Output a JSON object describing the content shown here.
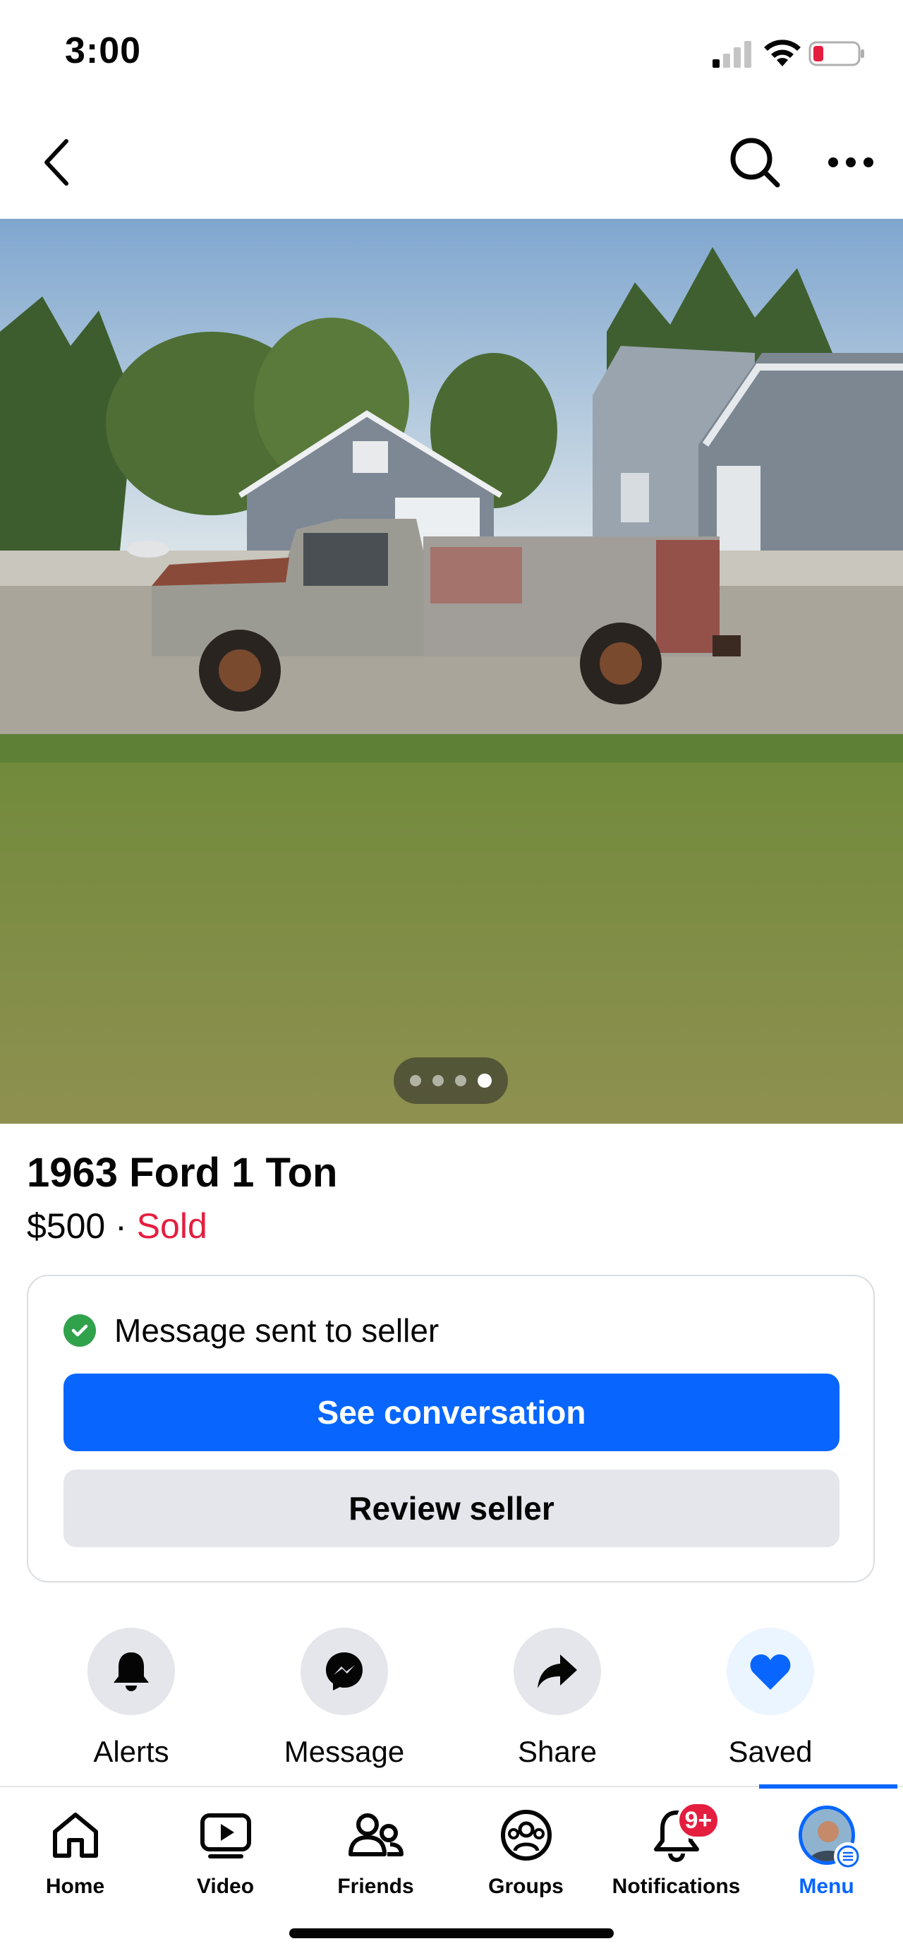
{
  "status_bar": {
    "time": "3:00"
  },
  "nav": {
    "back_icon": "chevron-left-icon",
    "search_icon": "search-icon",
    "more_icon": "more-horizontal-icon"
  },
  "photo": {
    "pager": {
      "count": 4,
      "active": 4
    }
  },
  "listing": {
    "title": "1963 Ford 1 Ton",
    "price": "$500",
    "separator": " · ",
    "status": "Sold",
    "status_color": "#e41e3f"
  },
  "message_card": {
    "status_text": "Message sent to seller",
    "primary_button": "See conversation",
    "secondary_button": "Review seller"
  },
  "actions": [
    {
      "label": "Alerts",
      "icon": "bell-icon"
    },
    {
      "label": "Message",
      "icon": "messenger-icon"
    },
    {
      "label": "Share",
      "icon": "share-arrow-icon"
    },
    {
      "label": "Saved",
      "icon": "heart-icon"
    }
  ],
  "tabbar": {
    "tabs": [
      {
        "label": "Home",
        "icon": "home-icon"
      },
      {
        "label": "Video",
        "icon": "video-icon"
      },
      {
        "label": "Friends",
        "icon": "friends-icon"
      },
      {
        "label": "Groups",
        "icon": "groups-icon"
      },
      {
        "label": "Notifications",
        "icon": "bell-icon",
        "badge": "9+"
      },
      {
        "label": "Menu",
        "icon": "avatar",
        "active": true
      }
    ]
  },
  "colors": {
    "accent": "#0866ff",
    "badge": "#e41e3f",
    "success": "#31a24c"
  }
}
